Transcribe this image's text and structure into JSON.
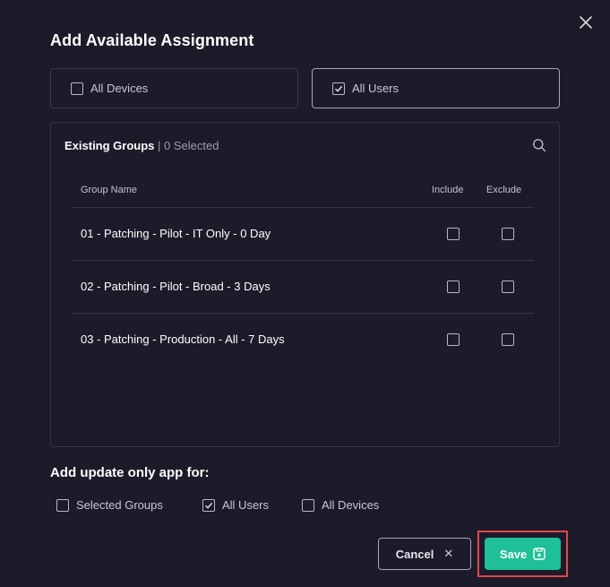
{
  "dialog": {
    "title": "Add Available Assignment"
  },
  "targets": [
    {
      "label": "All Devices",
      "checked": false
    },
    {
      "label": "All Users",
      "checked": true
    }
  ],
  "groups": {
    "header_title": "Existing Groups",
    "header_separator": " | ",
    "selected_count": "0 Selected",
    "columns": {
      "name": "Group Name",
      "include": "Include",
      "exclude": "Exclude"
    },
    "rows": [
      {
        "name": "01 - Patching - Pilot - IT Only - 0 Day",
        "include": false,
        "exclude": false
      },
      {
        "name": "02 - Patching - Pilot - Broad - 3 Days",
        "include": false,
        "exclude": false
      },
      {
        "name": "03 - Patching - Production - All - 7 Days",
        "include": false,
        "exclude": false
      }
    ]
  },
  "update_only": {
    "title": "Add update only app for:",
    "options": [
      {
        "label": "Selected Groups",
        "checked": false
      },
      {
        "label": "All Users",
        "checked": true
      },
      {
        "label": "All Devices",
        "checked": false
      }
    ]
  },
  "footer": {
    "cancel_label": "Cancel",
    "save_label": "Save"
  },
  "colors": {
    "background": "#1c1b29",
    "accent": "#1fbf98",
    "highlight": "#e0474c"
  },
  "icons": {
    "close": "close-icon",
    "search": "search-icon",
    "check": "check-icon",
    "save": "save-icon",
    "cancel": "x-icon"
  }
}
